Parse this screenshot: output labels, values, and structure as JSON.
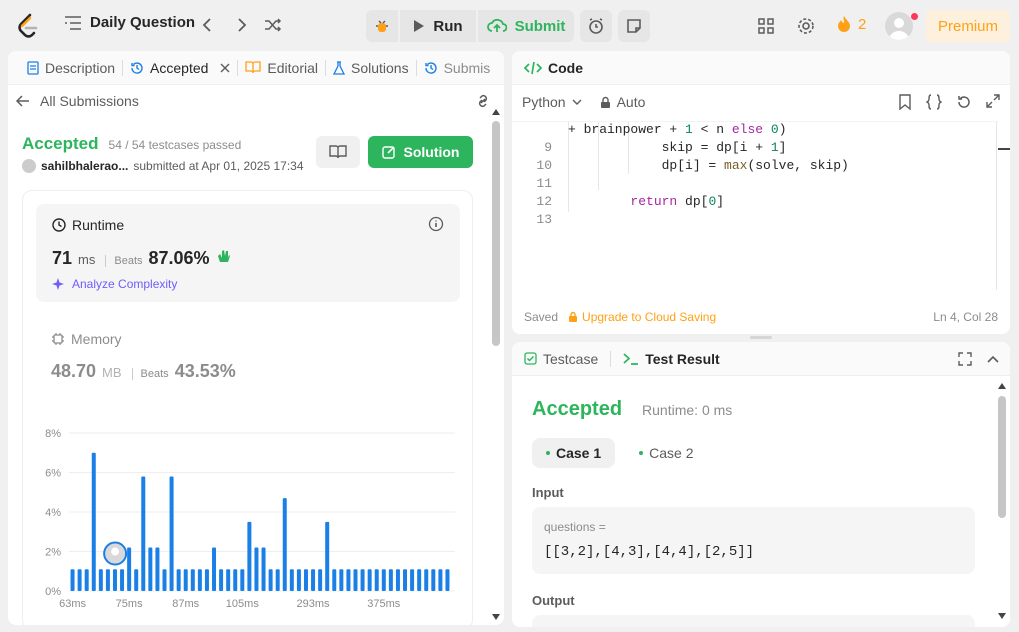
{
  "topbar": {
    "title": "Daily Question",
    "run_label": "Run",
    "submit_label": "Submit",
    "streak_count": "2",
    "premium_label": "Premium",
    "icons": [
      "leetcode-logo-icon",
      "list-icon",
      "chevron-left-icon",
      "chevron-right-icon",
      "shuffle-icon",
      "debug-icon",
      "play-icon",
      "cloud-upload-icon",
      "alarm-icon",
      "note-icon",
      "grid-icon",
      "gear-icon",
      "fire-icon",
      "avatar"
    ]
  },
  "left_tabs": [
    {
      "label": "Description"
    },
    {
      "label": "Accepted"
    },
    {
      "label": "Editorial"
    },
    {
      "label": "Solutions"
    },
    {
      "label": "Submis"
    }
  ],
  "submission": {
    "back_label": "All Submissions",
    "status": "Accepted",
    "testcases": "54 / 54 testcases passed",
    "author": "sahilbhalerao...",
    "submitted_at": "submitted at Apr 01, 2025 17:34",
    "solution_button": "Solution",
    "runtime_label": "Runtime",
    "runtime_value": "71",
    "runtime_unit": "ms",
    "runtime_beats_label": "Beats",
    "runtime_beats": "87.06%",
    "analyze_label": "Analyze Complexity",
    "memory_label": "Memory",
    "memory_value": "48.70",
    "memory_unit": "MB",
    "memory_beats_label": "Beats",
    "memory_beats": "43.53%"
  },
  "chart_data": {
    "type": "bar",
    "ylim": [
      0,
      8
    ],
    "y_ticks": [
      "0%",
      "2%",
      "4%",
      "6%",
      "8%"
    ],
    "x_tick_labels": [
      "63ms",
      "75ms",
      "87ms",
      "105ms",
      "293ms",
      "375ms"
    ],
    "values": [
      1.1,
      1.1,
      1.1,
      7.0,
      1.1,
      1.1,
      1.1,
      1.1,
      2.2,
      1.1,
      5.8,
      2.2,
      2.2,
      1.1,
      5.8,
      1.1,
      1.1,
      1.1,
      1.1,
      1.1,
      2.2,
      1.1,
      1.1,
      1.1,
      1.1,
      3.5,
      2.2,
      2.2,
      1.1,
      1.1,
      4.7,
      1.1,
      1.1,
      1.1,
      1.1,
      1.1,
      3.5,
      1.1,
      1.1,
      1.1,
      1.1,
      1.1,
      1.1,
      1.1,
      1.1,
      1.1,
      1.1,
      1.1,
      1.1,
      1.1,
      1.1,
      1.1,
      1.1,
      1.1
    ],
    "highlight_index": 8,
    "bar_color": "#1a7fe6"
  },
  "code_panel": {
    "title": "Code",
    "language": "Python",
    "mode": "Auto",
    "lines": [
      {
        "n": "",
        "text": "+ brainpower + 1 < n else 0)"
      },
      {
        "n": "9",
        "text": "            skip = dp[i + 1]"
      },
      {
        "n": "10",
        "text": "            dp[i] = max(solve, skip)"
      },
      {
        "n": "11",
        "text": ""
      },
      {
        "n": "12",
        "text": "        return dp[0]"
      },
      {
        "n": "13",
        "text": ""
      }
    ],
    "saved": "Saved",
    "upgrade": "Upgrade to Cloud Saving",
    "cursor": "Ln 4, Col 28"
  },
  "result_panel": {
    "testcase_tab": "Testcase",
    "result_tab": "Test Result",
    "status": "Accepted",
    "runtime": "Runtime: 0 ms",
    "cases": [
      "Case 1",
      "Case 2"
    ],
    "input_label": "Input",
    "input_key": "questions =",
    "input_value": "[[3,2],[4,3],[4,4],[2,5]]",
    "output_label": "Output"
  },
  "colors": {
    "accent_green": "#2db55d",
    "premium_orange": "#ffa116",
    "analyze_purple": "#6f5dfc"
  }
}
